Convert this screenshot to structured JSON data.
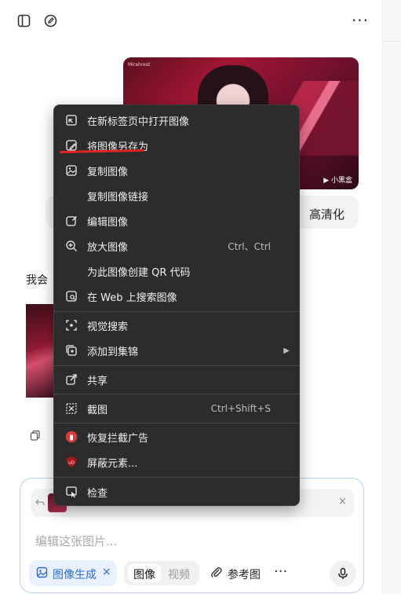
{
  "topbar": {
    "sidebar_icon": "sidebar-toggle-icon",
    "new_chat_icon": "edit-icon",
    "more_label": "···"
  },
  "hero_image": {
    "watermark_left": "Mirahrest",
    "watermark_right": "▶ 小黑盒"
  },
  "chip": {
    "label": "高清化"
  },
  "assistant_text": "我会",
  "context_menu": {
    "items": [
      {
        "label": "在新标签页中打开图像",
        "shortcut": "",
        "icon": "open-new-tab-icon"
      },
      {
        "label": "将图像另存为",
        "shortcut": "",
        "icon": "save-image-icon"
      },
      {
        "label": "复制图像",
        "shortcut": "",
        "icon": "copy-image-icon"
      },
      {
        "label": "复制图像链接",
        "shortcut": "",
        "icon": ""
      },
      {
        "label": "编辑图像",
        "shortcut": "",
        "icon": "edit-image-icon"
      },
      {
        "label": "放大图像",
        "shortcut": "Ctrl、Ctrl",
        "icon": "zoom-in-icon"
      },
      {
        "label": "为此图像创建 QR 代码",
        "shortcut": "",
        "icon": ""
      },
      {
        "label": "在 Web 上搜索图像",
        "shortcut": "",
        "icon": "search-image-icon"
      },
      {
        "label": "视觉搜索",
        "shortcut": "",
        "icon": "visual-search-icon"
      },
      {
        "label": "添加到集锦",
        "shortcut": "",
        "icon": "collections-icon"
      },
      {
        "label": "共享",
        "shortcut": "",
        "icon": "share-icon"
      },
      {
        "label": "截图",
        "shortcut": "Ctrl+Shift+S",
        "icon": "screenshot-icon"
      },
      {
        "label": "恢复拦截广告",
        "shortcut": "",
        "icon": "adblock-icon"
      },
      {
        "label": "屏蔽元素...",
        "shortcut": "",
        "icon": "ublock-icon"
      },
      {
        "label": "检查",
        "shortcut": "",
        "icon": "inspect-icon"
      }
    ]
  },
  "composer": {
    "placeholder": "编辑这张图片...",
    "generate_label": "图像生成",
    "generate_close": "×",
    "mode_image": "图像",
    "mode_video": "视频",
    "reference_label": "参考图",
    "more_label": "···",
    "ref_close": "×"
  },
  "colors": {
    "accent": "#2a6be0",
    "menu_bg": "#2c2c2c",
    "annotation": "#e02424"
  }
}
